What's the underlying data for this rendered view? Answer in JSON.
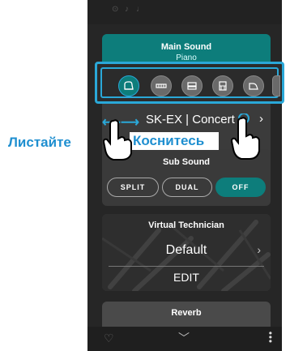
{
  "main_sound": {
    "title": "Main Sound",
    "subtitle": "Piano",
    "model": "SK-EX | Concert"
  },
  "labels": {
    "swipe": "Листайте",
    "tap": "Коснитесь"
  },
  "sub_sound": {
    "title": "Sub Sound",
    "buttons": [
      "SPLIT",
      "DUAL",
      "OFF"
    ]
  },
  "virtual_technician": {
    "title": "Virtual Technician",
    "value": "Default",
    "edit": "EDIT"
  },
  "reverb": {
    "title": "Reverb"
  },
  "icons": [
    "grand-piano-icon",
    "keyboard-icon",
    "upright-piano-icon",
    "console-piano-icon",
    "grand-piano-small-icon"
  ],
  "colors": {
    "accent": "#0d7d7b",
    "highlight": "#2aa8d8",
    "label": "#1f8fd0"
  }
}
